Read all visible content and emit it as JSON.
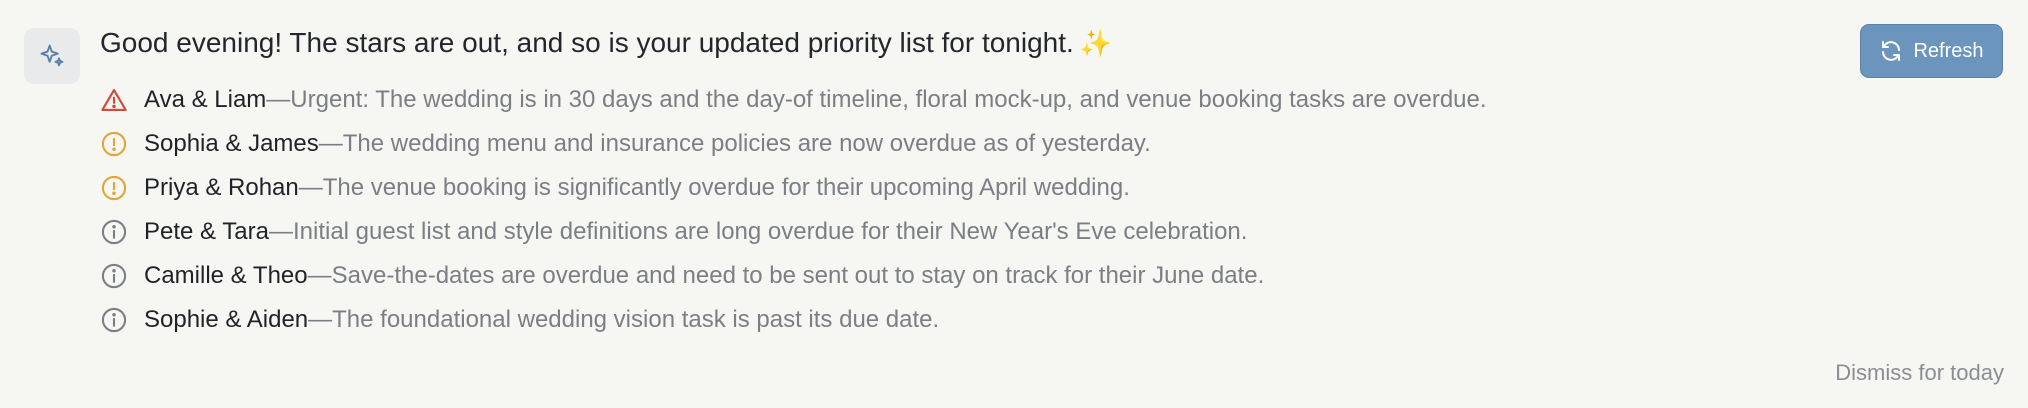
{
  "header": {
    "title": "Good evening! The stars are out, and so is your updated priority list for tonight.",
    "title_emoji": "✨",
    "badge_icon": "sparkle-icon"
  },
  "actions": {
    "refresh_label": "Refresh",
    "refresh_icon": "refresh-icon",
    "dismiss_label": "Dismiss for today"
  },
  "colors": {
    "danger": "#d0493a",
    "warning": "#e2a53a",
    "info": "#7b7f85",
    "accent": "#6c95bd"
  },
  "items": [
    {
      "icon": "warning-triangle-icon",
      "severity": "danger",
      "name": "Ava & Liam",
      "sep": " — ",
      "text": "Urgent: The wedding is in 30 days and the day-of timeline, floral mock-up, and venue booking tasks are overdue."
    },
    {
      "icon": "alert-circle-icon",
      "severity": "warning",
      "name": "Sophia & James",
      "sep": " — ",
      "text": "The wedding menu and insurance policies are now overdue as of yesterday."
    },
    {
      "icon": "alert-circle-icon",
      "severity": "warning",
      "name": "Priya & Rohan",
      "sep": " — ",
      "text": "The venue booking is significantly overdue for their upcoming April wedding."
    },
    {
      "icon": "info-circle-icon",
      "severity": "info",
      "name": "Pete & Tara",
      "sep": " — ",
      "text": "Initial guest list and style definitions are long overdue for their New Year's Eve celebration."
    },
    {
      "icon": "info-circle-icon",
      "severity": "info",
      "name": "Camille & Theo",
      "sep": " — ",
      "text": "Save-the-dates are overdue and need to be sent out to stay on track for their June date."
    },
    {
      "icon": "info-circle-icon",
      "severity": "info",
      "name": "Sophie & Aiden",
      "sep": " — ",
      "text": "The foundational wedding vision task is past its due date."
    }
  ]
}
